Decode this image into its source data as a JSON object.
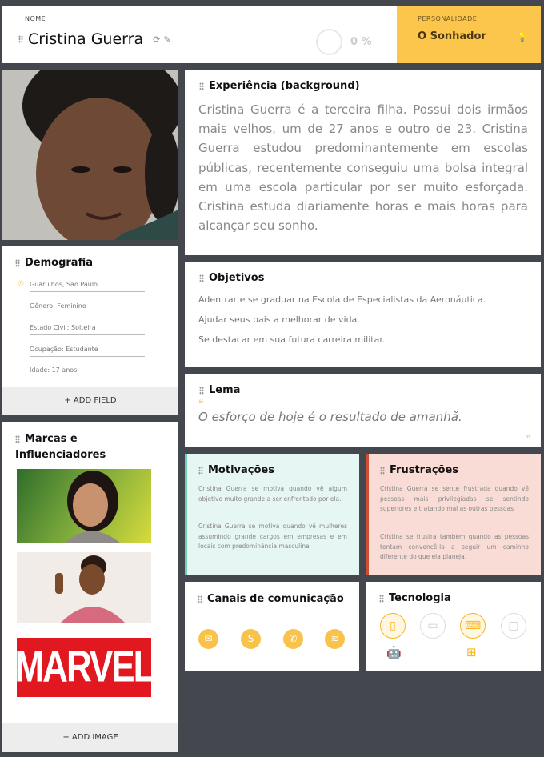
{
  "header": {
    "name_label": "NOME",
    "name": "Cristina Guerra",
    "progress": "0 %",
    "personality_label": "PERSONALIDADE",
    "personality": "O Sonhador"
  },
  "demographics": {
    "title": "Demografia",
    "location": "Guarulhos, São Paulo",
    "gender": "Gênero: Feminino",
    "civil_status": "Estado Civil: Solteira",
    "occupation": "Ocupação: Estudante",
    "age": "Idade: 17 anos",
    "add_field": "+ ADD FIELD"
  },
  "brands": {
    "title": "Marcas e Influenciadores",
    "marvel": "MARVEL",
    "add_image": "+ ADD IMAGE"
  },
  "experience": {
    "title": "Experiência (background)",
    "text": "Cristina Guerra é a terceira filha. Possui dois irmãos mais velhos, um de 27 anos e outro de 23. Cristina Guerra estudou predominantemente em escolas públicas, recentemente conseguiu uma bolsa integral em uma escola particular por ser muito esforçada. Cristina estuda diariamente horas e mais horas para alcançar seu sonho."
  },
  "goals": {
    "title": "Objetivos",
    "items": [
      "Adentrar e se graduar na Escola de Especialistas da Aeronáutica.",
      "Ajudar seus pais a melhorar de vida.",
      "Se destacar em sua futura carreira militar."
    ]
  },
  "motto": {
    "title": "Lema",
    "text": "O esforço de hoje é o resultado de amanhã."
  },
  "motivations": {
    "title": "Motivações",
    "items": [
      "Cristina Guerra se motiva quando vê algum objetivo muito grande a ser enfrentado por ela.",
      "Cristina Guerra se motiva quando vê mulheres assumindo grande cargos em empresas e em locais com predominância masculina"
    ]
  },
  "frustrations": {
    "title": "Frustrações",
    "items": [
      "Cristina Guerra se sente frustrada quando vê pessoas mais privilegiadas se sentindo superiores e tratando mal as outras pessoas",
      "Cristina se frustra também quando as pessoas tentam convencê-la a seguir um caminho diferente do que ela planeja."
    ]
  },
  "channels": {
    "title": "Canais de comunicação",
    "icons": [
      "email-icon",
      "skype-icon",
      "whatsapp-icon",
      "spotify-icon"
    ]
  },
  "technology": {
    "title": "Tecnologia",
    "devices": [
      {
        "icon": "smartphone-icon",
        "selected": true
      },
      {
        "icon": "tablet-icon",
        "selected": false
      },
      {
        "icon": "laptop-icon",
        "selected": true
      },
      {
        "icon": "desktop-icon",
        "selected": false
      }
    ],
    "os": [
      "android-icon",
      "windows-icon"
    ]
  },
  "colors": {
    "accent": "#fcc64c",
    "background": "#45474e",
    "motivation_bg": "#e6f6f2",
    "frustration_bg": "#fadcd6"
  }
}
